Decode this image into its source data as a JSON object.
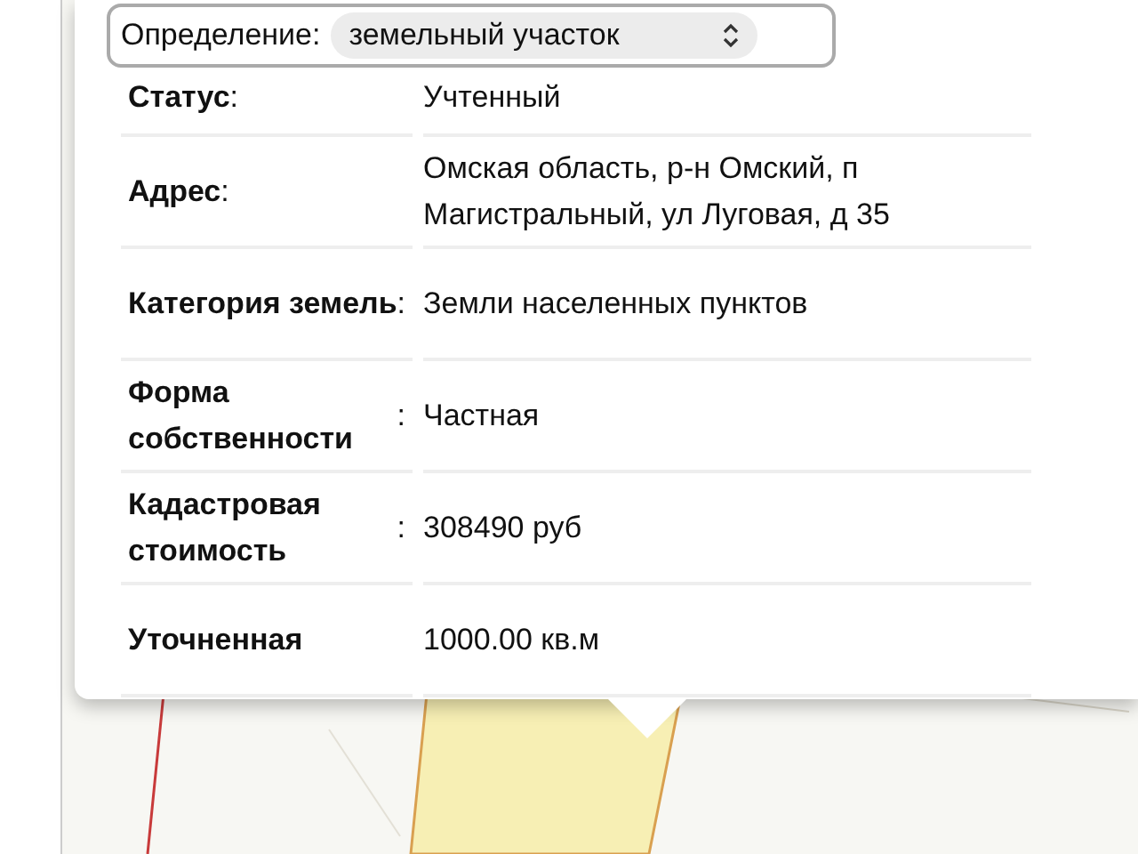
{
  "selector": {
    "label": "Определение:",
    "value": "земельный участок"
  },
  "rows": [
    {
      "label": "**Статус**:",
      "value": "Учтенный"
    },
    {
      "label": "**Адрес**:",
      "value": "Омская область, р-н Омский, п Магистральный, ул Луговая, д 35"
    },
    {
      "label": "**Категория земель**:",
      "value": "Земли населенных пунктов"
    },
    {
      "label": "**Форма собственности**:",
      "value": "Частная"
    },
    {
      "label": "**Кадастровая стоимость**:",
      "value": "308490 руб"
    },
    {
      "label": "**Уточненная**",
      "value": "1000.00 кв.м"
    }
  ]
}
